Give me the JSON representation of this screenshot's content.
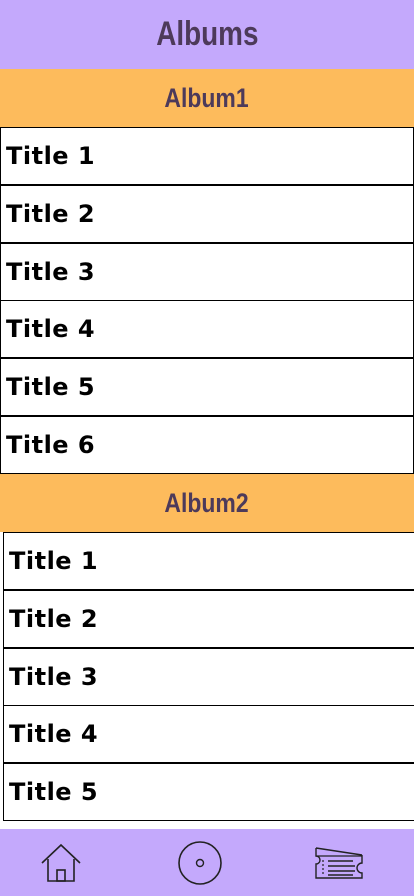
{
  "header": {
    "title": "Albums"
  },
  "albums": [
    {
      "name": "Album1",
      "tracks": [
        "Title 1",
        "Title 2",
        "Title 3",
        "Title 4",
        "Title 5",
        "Title 6"
      ]
    },
    {
      "name": "Album2",
      "tracks": [
        "Title 1",
        "Title 2",
        "Title 3",
        "Title 4",
        "Title 5"
      ]
    }
  ],
  "bottom_nav": {
    "items": [
      {
        "icon": "home-icon"
      },
      {
        "icon": "disc-icon"
      },
      {
        "icon": "ticket-icon"
      }
    ]
  },
  "colors": {
    "header_bg": "#c4a9fc",
    "album_header_bg": "#fdbb5c",
    "title_text": "#4d3a5a"
  }
}
